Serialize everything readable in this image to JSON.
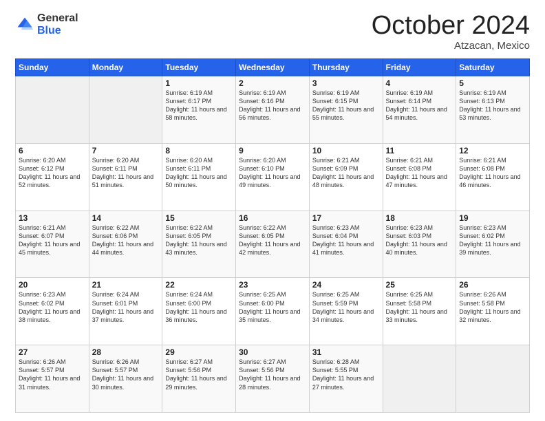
{
  "logo": {
    "general": "General",
    "blue": "Blue"
  },
  "title": "October 2024",
  "location": "Atzacan, Mexico",
  "days_of_week": [
    "Sunday",
    "Monday",
    "Tuesday",
    "Wednesday",
    "Thursday",
    "Friday",
    "Saturday"
  ],
  "weeks": [
    [
      {
        "num": "",
        "sunrise": "",
        "sunset": "",
        "daylight": ""
      },
      {
        "num": "",
        "sunrise": "",
        "sunset": "",
        "daylight": ""
      },
      {
        "num": "1",
        "sunrise": "Sunrise: 6:19 AM",
        "sunset": "Sunset: 6:17 PM",
        "daylight": "Daylight: 11 hours and 58 minutes."
      },
      {
        "num": "2",
        "sunrise": "Sunrise: 6:19 AM",
        "sunset": "Sunset: 6:16 PM",
        "daylight": "Daylight: 11 hours and 56 minutes."
      },
      {
        "num": "3",
        "sunrise": "Sunrise: 6:19 AM",
        "sunset": "Sunset: 6:15 PM",
        "daylight": "Daylight: 11 hours and 55 minutes."
      },
      {
        "num": "4",
        "sunrise": "Sunrise: 6:19 AM",
        "sunset": "Sunset: 6:14 PM",
        "daylight": "Daylight: 11 hours and 54 minutes."
      },
      {
        "num": "5",
        "sunrise": "Sunrise: 6:19 AM",
        "sunset": "Sunset: 6:13 PM",
        "daylight": "Daylight: 11 hours and 53 minutes."
      }
    ],
    [
      {
        "num": "6",
        "sunrise": "Sunrise: 6:20 AM",
        "sunset": "Sunset: 6:12 PM",
        "daylight": "Daylight: 11 hours and 52 minutes."
      },
      {
        "num": "7",
        "sunrise": "Sunrise: 6:20 AM",
        "sunset": "Sunset: 6:11 PM",
        "daylight": "Daylight: 11 hours and 51 minutes."
      },
      {
        "num": "8",
        "sunrise": "Sunrise: 6:20 AM",
        "sunset": "Sunset: 6:11 PM",
        "daylight": "Daylight: 11 hours and 50 minutes."
      },
      {
        "num": "9",
        "sunrise": "Sunrise: 6:20 AM",
        "sunset": "Sunset: 6:10 PM",
        "daylight": "Daylight: 11 hours and 49 minutes."
      },
      {
        "num": "10",
        "sunrise": "Sunrise: 6:21 AM",
        "sunset": "Sunset: 6:09 PM",
        "daylight": "Daylight: 11 hours and 48 minutes."
      },
      {
        "num": "11",
        "sunrise": "Sunrise: 6:21 AM",
        "sunset": "Sunset: 6:08 PM",
        "daylight": "Daylight: 11 hours and 47 minutes."
      },
      {
        "num": "12",
        "sunrise": "Sunrise: 6:21 AM",
        "sunset": "Sunset: 6:08 PM",
        "daylight": "Daylight: 11 hours and 46 minutes."
      }
    ],
    [
      {
        "num": "13",
        "sunrise": "Sunrise: 6:21 AM",
        "sunset": "Sunset: 6:07 PM",
        "daylight": "Daylight: 11 hours and 45 minutes."
      },
      {
        "num": "14",
        "sunrise": "Sunrise: 6:22 AM",
        "sunset": "Sunset: 6:06 PM",
        "daylight": "Daylight: 11 hours and 44 minutes."
      },
      {
        "num": "15",
        "sunrise": "Sunrise: 6:22 AM",
        "sunset": "Sunset: 6:05 PM",
        "daylight": "Daylight: 11 hours and 43 minutes."
      },
      {
        "num": "16",
        "sunrise": "Sunrise: 6:22 AM",
        "sunset": "Sunset: 6:05 PM",
        "daylight": "Daylight: 11 hours and 42 minutes."
      },
      {
        "num": "17",
        "sunrise": "Sunrise: 6:23 AM",
        "sunset": "Sunset: 6:04 PM",
        "daylight": "Daylight: 11 hours and 41 minutes."
      },
      {
        "num": "18",
        "sunrise": "Sunrise: 6:23 AM",
        "sunset": "Sunset: 6:03 PM",
        "daylight": "Daylight: 11 hours and 40 minutes."
      },
      {
        "num": "19",
        "sunrise": "Sunrise: 6:23 AM",
        "sunset": "Sunset: 6:02 PM",
        "daylight": "Daylight: 11 hours and 39 minutes."
      }
    ],
    [
      {
        "num": "20",
        "sunrise": "Sunrise: 6:23 AM",
        "sunset": "Sunset: 6:02 PM",
        "daylight": "Daylight: 11 hours and 38 minutes."
      },
      {
        "num": "21",
        "sunrise": "Sunrise: 6:24 AM",
        "sunset": "Sunset: 6:01 PM",
        "daylight": "Daylight: 11 hours and 37 minutes."
      },
      {
        "num": "22",
        "sunrise": "Sunrise: 6:24 AM",
        "sunset": "Sunset: 6:00 PM",
        "daylight": "Daylight: 11 hours and 36 minutes."
      },
      {
        "num": "23",
        "sunrise": "Sunrise: 6:25 AM",
        "sunset": "Sunset: 6:00 PM",
        "daylight": "Daylight: 11 hours and 35 minutes."
      },
      {
        "num": "24",
        "sunrise": "Sunrise: 6:25 AM",
        "sunset": "Sunset: 5:59 PM",
        "daylight": "Daylight: 11 hours and 34 minutes."
      },
      {
        "num": "25",
        "sunrise": "Sunrise: 6:25 AM",
        "sunset": "Sunset: 5:58 PM",
        "daylight": "Daylight: 11 hours and 33 minutes."
      },
      {
        "num": "26",
        "sunrise": "Sunrise: 6:26 AM",
        "sunset": "Sunset: 5:58 PM",
        "daylight": "Daylight: 11 hours and 32 minutes."
      }
    ],
    [
      {
        "num": "27",
        "sunrise": "Sunrise: 6:26 AM",
        "sunset": "Sunset: 5:57 PM",
        "daylight": "Daylight: 11 hours and 31 minutes."
      },
      {
        "num": "28",
        "sunrise": "Sunrise: 6:26 AM",
        "sunset": "Sunset: 5:57 PM",
        "daylight": "Daylight: 11 hours and 30 minutes."
      },
      {
        "num": "29",
        "sunrise": "Sunrise: 6:27 AM",
        "sunset": "Sunset: 5:56 PM",
        "daylight": "Daylight: 11 hours and 29 minutes."
      },
      {
        "num": "30",
        "sunrise": "Sunrise: 6:27 AM",
        "sunset": "Sunset: 5:56 PM",
        "daylight": "Daylight: 11 hours and 28 minutes."
      },
      {
        "num": "31",
        "sunrise": "Sunrise: 6:28 AM",
        "sunset": "Sunset: 5:55 PM",
        "daylight": "Daylight: 11 hours and 27 minutes."
      },
      {
        "num": "",
        "sunrise": "",
        "sunset": "",
        "daylight": ""
      },
      {
        "num": "",
        "sunrise": "",
        "sunset": "",
        "daylight": ""
      }
    ]
  ]
}
